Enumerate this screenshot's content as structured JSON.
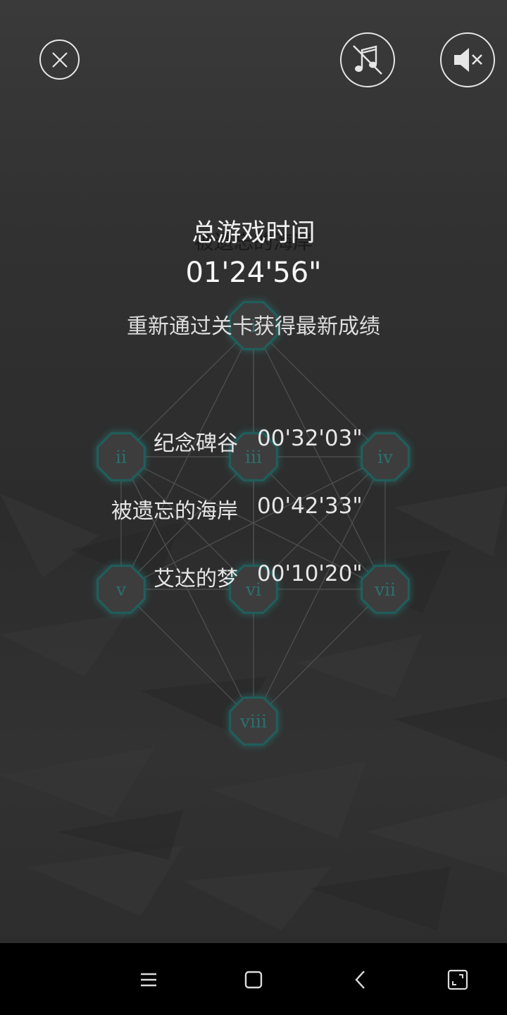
{
  "controls": {
    "close_icon": "close-circle-icon",
    "music_icon": "music-off-icon",
    "sound_icon": "sound-mute-icon"
  },
  "background_title": "被遗忘的海岸",
  "stats": {
    "total_label": "总游戏时间",
    "total_time": "01'24'56\"",
    "replay_note": "重新通过关卡获得最新成绩",
    "levels": [
      {
        "name": "纪念碑谷",
        "time": "00'32'03\""
      },
      {
        "name": "被遗忘的海岸",
        "time": "00'42'33\""
      },
      {
        "name": "艾达的梦",
        "time": "00'10'20\""
      }
    ]
  },
  "level_map": {
    "nodes": [
      {
        "label": "i"
      },
      {
        "label": "ii"
      },
      {
        "label": "iii"
      },
      {
        "label": "iv"
      },
      {
        "label": "v"
      },
      {
        "label": "vi"
      },
      {
        "label": "vii"
      },
      {
        "label": "viii"
      }
    ],
    "colors": {
      "node_fill": "#3d3d3d",
      "node_border": "#1f5f5c",
      "node_glow": "#2a8a85",
      "label": "#2c6f6d"
    }
  },
  "nav": {
    "menu_icon": "menu-lines-icon",
    "home_icon": "home-square-icon",
    "back_icon": "back-chevron-icon",
    "rotate_icon": "rotate-screen-icon"
  }
}
